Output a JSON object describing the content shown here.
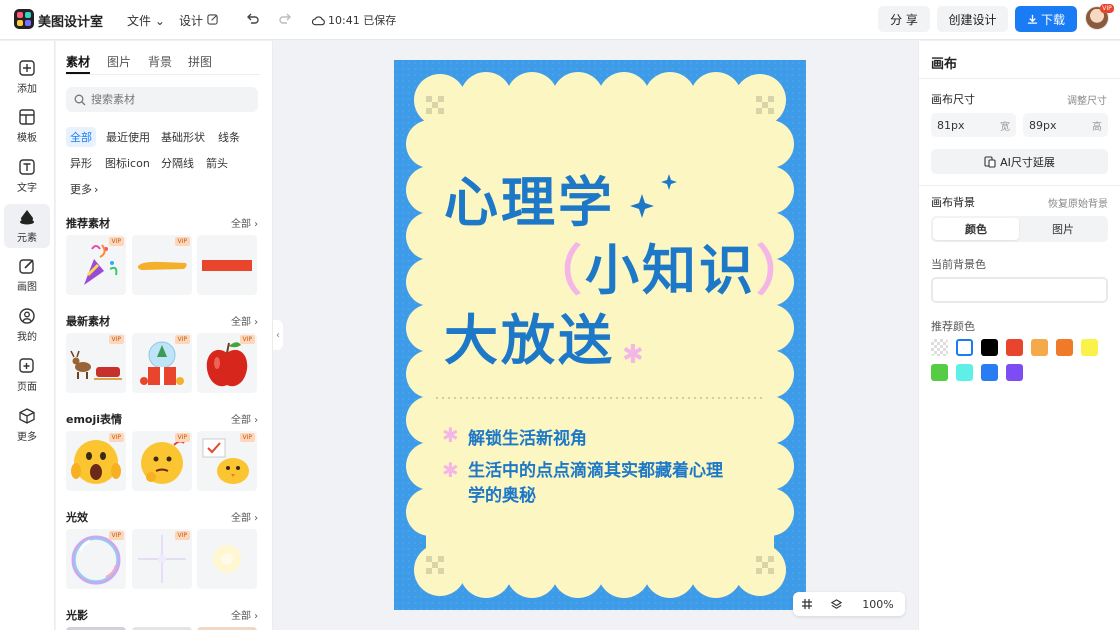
{
  "app": {
    "name": "美图设计室"
  },
  "header": {
    "menu_file": "文件",
    "menu_design": "设计",
    "saved_status": "10:41 已保存",
    "share_label": "分 享",
    "create_label": "创建设计",
    "download_label": "下载",
    "avatar_badge": "VIP"
  },
  "rail": {
    "items": [
      {
        "label": "添加",
        "icon": "plus-square-icon"
      },
      {
        "label": "模板",
        "icon": "template-grid-icon"
      },
      {
        "label": "文字",
        "icon": "text-icon"
      },
      {
        "label": "元素",
        "icon": "shapes-icon"
      },
      {
        "label": "画图",
        "icon": "pencil-icon"
      },
      {
        "label": "我的",
        "icon": "user-icon"
      },
      {
        "label": "页面",
        "icon": "page-add-icon"
      },
      {
        "label": "更多",
        "icon": "cube-icon"
      }
    ]
  },
  "panel": {
    "tabs": [
      "素材",
      "图片",
      "背景",
      "拼图"
    ],
    "search_placeholder": "搜索素材",
    "chips": [
      "全部",
      "最近使用",
      "基础形状",
      "线条",
      "异形",
      "图标icon",
      "分隔线",
      "箭头",
      "更多"
    ],
    "all_label": "全部",
    "vip_label": "VIP",
    "sections": [
      {
        "title": "推荐素材"
      },
      {
        "title": "最新素材"
      },
      {
        "title": "emoji表情"
      },
      {
        "title": "光效"
      },
      {
        "title": "光影"
      }
    ]
  },
  "poster": {
    "title_line1": "心理学",
    "title_line2_open": "（",
    "title_line2": "小知识",
    "title_line2_close": "）",
    "title_line3": "大放送",
    "bullet_symbol": "✱",
    "bullet1": "解锁生活新视角",
    "bullet2_line1": "生活中的点点滴滴其实都藏着心理",
    "bullet2_line2": "学的奥秘"
  },
  "zoom": {
    "level": "100%"
  },
  "rpanel": {
    "title": "画布",
    "size_label": "画布尺寸",
    "size_adjust": "调整尺寸",
    "width_value": "81px",
    "width_unit": "宽",
    "height_value": "89px",
    "height_unit": "高",
    "ai_extend": "AI尺寸延展",
    "bg_label": "画布背景",
    "bg_reset": "恢复原始背景",
    "seg_color": "颜色",
    "seg_image": "图片",
    "current_bg": "当前背景色",
    "recommend_colors": "推荐颜色",
    "swatches": [
      "transparent",
      "#ffffff",
      "#000000",
      "#e8452c",
      "#f4a94a",
      "#f07a2a",
      "#faf24a",
      "#55cc44",
      "#5ef0e6",
      "#2a7cf2",
      "#7b4df2"
    ]
  },
  "colors": {
    "accent": "#1a7cf5",
    "poster_bg": "#3e9be8",
    "poster_cream": "#fcf7c2",
    "poster_blue": "#1e78c8",
    "poster_pink": "#f3b6e6"
  }
}
